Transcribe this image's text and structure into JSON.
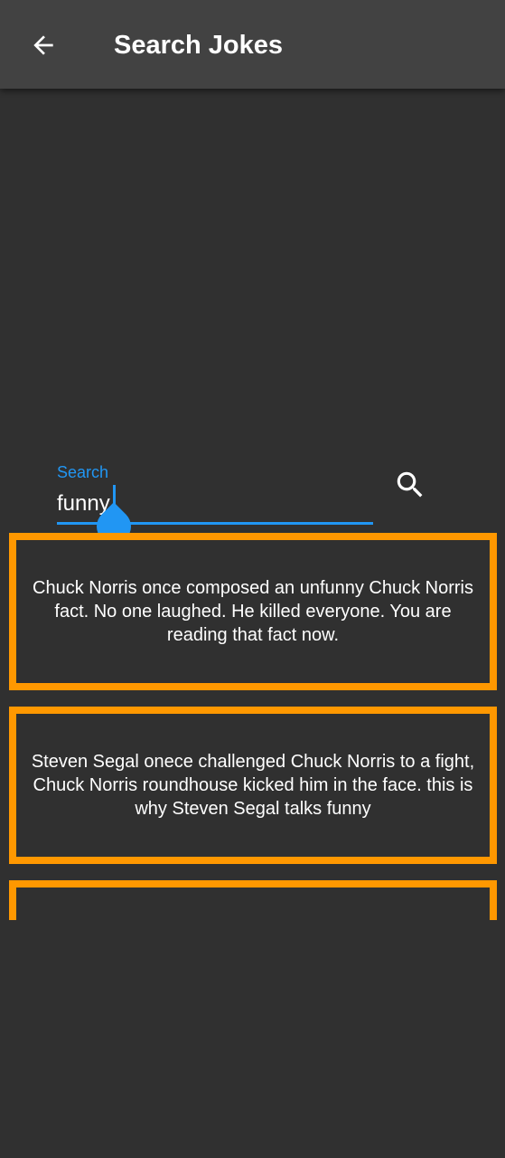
{
  "appbar": {
    "title": "Search Jokes",
    "back_icon": "arrow-back-icon"
  },
  "search": {
    "label": "Search",
    "value": "funny",
    "search_icon": "search-icon"
  },
  "jokes": [
    {
      "text": "Chuck Norris once composed an unfunny Chuck Norris fact. No one laughed. He killed everyone. You are reading that fact now."
    },
    {
      "text": "Steven Segal onece challenged Chuck Norris to a fight, Chuck Norris roundhouse kicked him in the face. this is why Steven Segal talks funny"
    },
    {
      "text": ""
    }
  ],
  "colors": {
    "background": "#303030",
    "appbar": "#424242",
    "accent": "#2196f3",
    "card_border": "#ff9800"
  }
}
